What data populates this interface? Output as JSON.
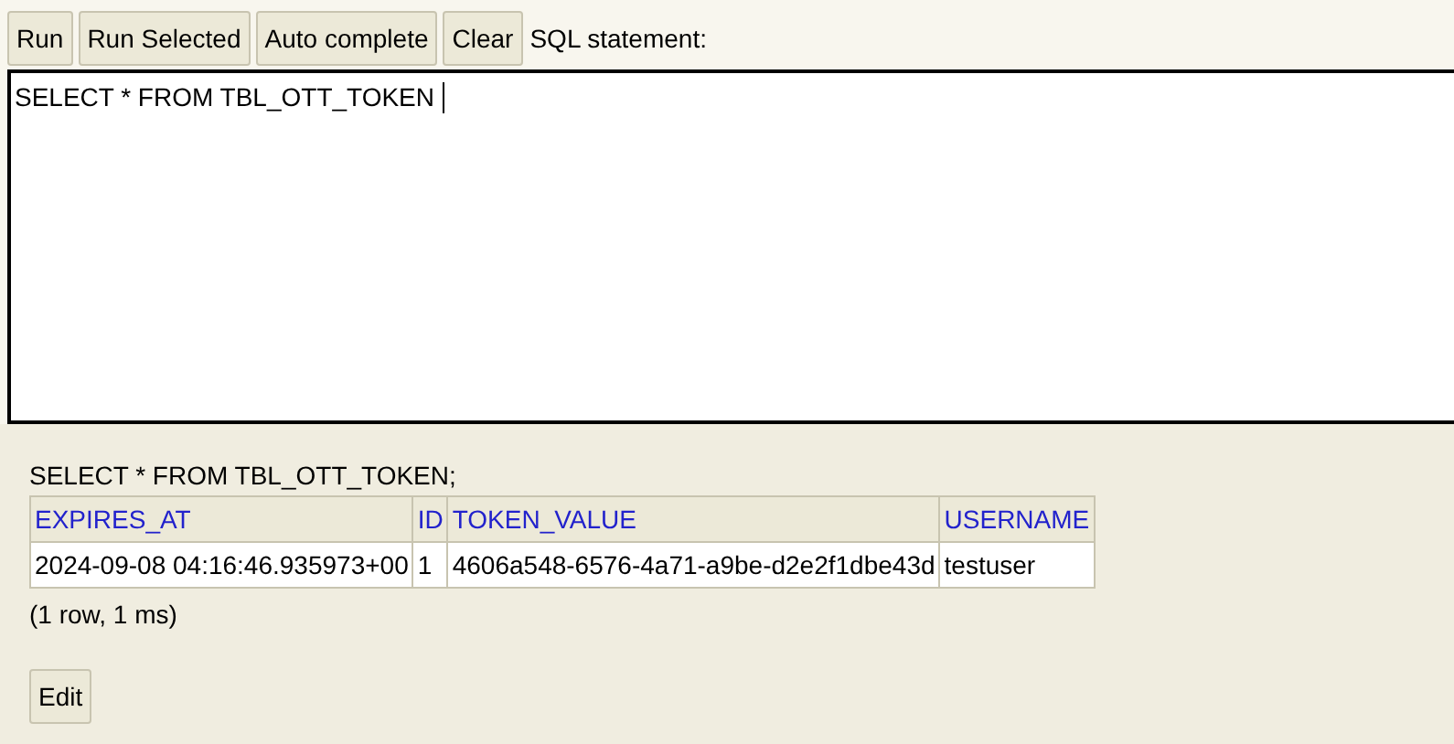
{
  "toolbar": {
    "buttons": [
      "Run",
      "Run Selected",
      "Auto complete",
      "Clear"
    ],
    "label": "SQL statement:"
  },
  "editor": {
    "value": "SELECT * FROM TBL_OTT_TOKEN"
  },
  "result": {
    "statement": "SELECT * FROM TBL_OTT_TOKEN;",
    "table": {
      "columns": [
        "EXPIRES_AT",
        "ID",
        "TOKEN_VALUE",
        "USERNAME"
      ],
      "rows": [
        [
          "2024-09-08 04:16:46.935973+00",
          "1",
          "4606a548-6576-4a71-a9be-d2e2f1dbe43d",
          "testuser"
        ]
      ]
    },
    "summary": "(1 row, 1 ms)",
    "edit_button": "Edit"
  }
}
